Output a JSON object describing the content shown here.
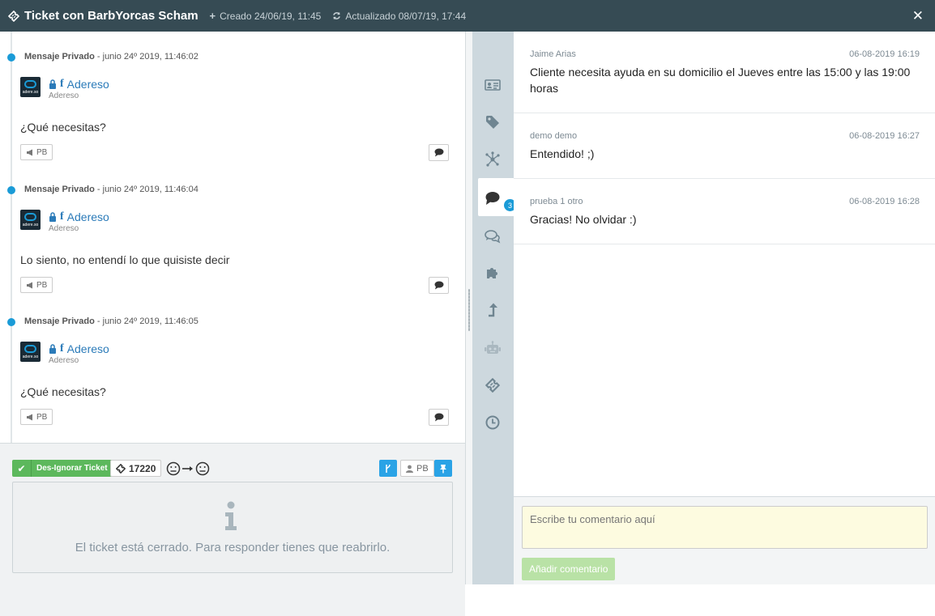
{
  "header": {
    "title": "Ticket con BarbYorcas Scham",
    "created": "Creado 24/06/19, 11:45",
    "updated": "Actualizado 08/07/19, 17:44"
  },
  "messages": [
    {
      "type": "Mensaje Privado",
      "date": "junio 24º 2019, 11:46:02",
      "author": "Adereso",
      "sub": "Adereso",
      "text": "¿Qué necesitas?",
      "tag": "PB"
    },
    {
      "type": "Mensaje Privado",
      "date": "junio 24º 2019, 11:46:04",
      "author": "Adereso",
      "sub": "Adereso",
      "text": "Lo siento, no entendí lo que quisiste decir",
      "tag": "PB"
    },
    {
      "type": "Mensaje Privado",
      "date": "junio 24º 2019, 11:46:05",
      "author": "Adereso",
      "sub": "Adereso",
      "text": "¿Qué necesitas?",
      "tag": "PB"
    }
  ],
  "avatar_text": "adere.so",
  "footer": {
    "ignore_label": "Des-Ignorar Ticket",
    "ticket_number": "17220",
    "pb_label": "PB",
    "closed_message": "El ticket está cerrado. Para responder tienes que reabrirlo."
  },
  "sidebar": {
    "comments_badge": "3"
  },
  "comments": [
    {
      "author": "Jaime Arias",
      "date": "06-08-2019 16:19",
      "text": "Cliente necesita ayuda en su domicilio el Jueves entre las 15:00 y las 19:00 horas"
    },
    {
      "author": "demo demo",
      "date": "06-08-2019 16:27",
      "text": "Entendido! ;)"
    },
    {
      "author": "prueba 1 otro",
      "date": "06-08-2019 16:28",
      "text": "Gracias! No olvidar :)"
    }
  ],
  "composer": {
    "placeholder": "Escribe tu comentario aquí",
    "add_label": "Añadir comentario"
  },
  "colors": {
    "header": "#364b54",
    "accent": "#1a9bd7",
    "success": "#5cb85c",
    "sidebar": "#cdd8de"
  }
}
